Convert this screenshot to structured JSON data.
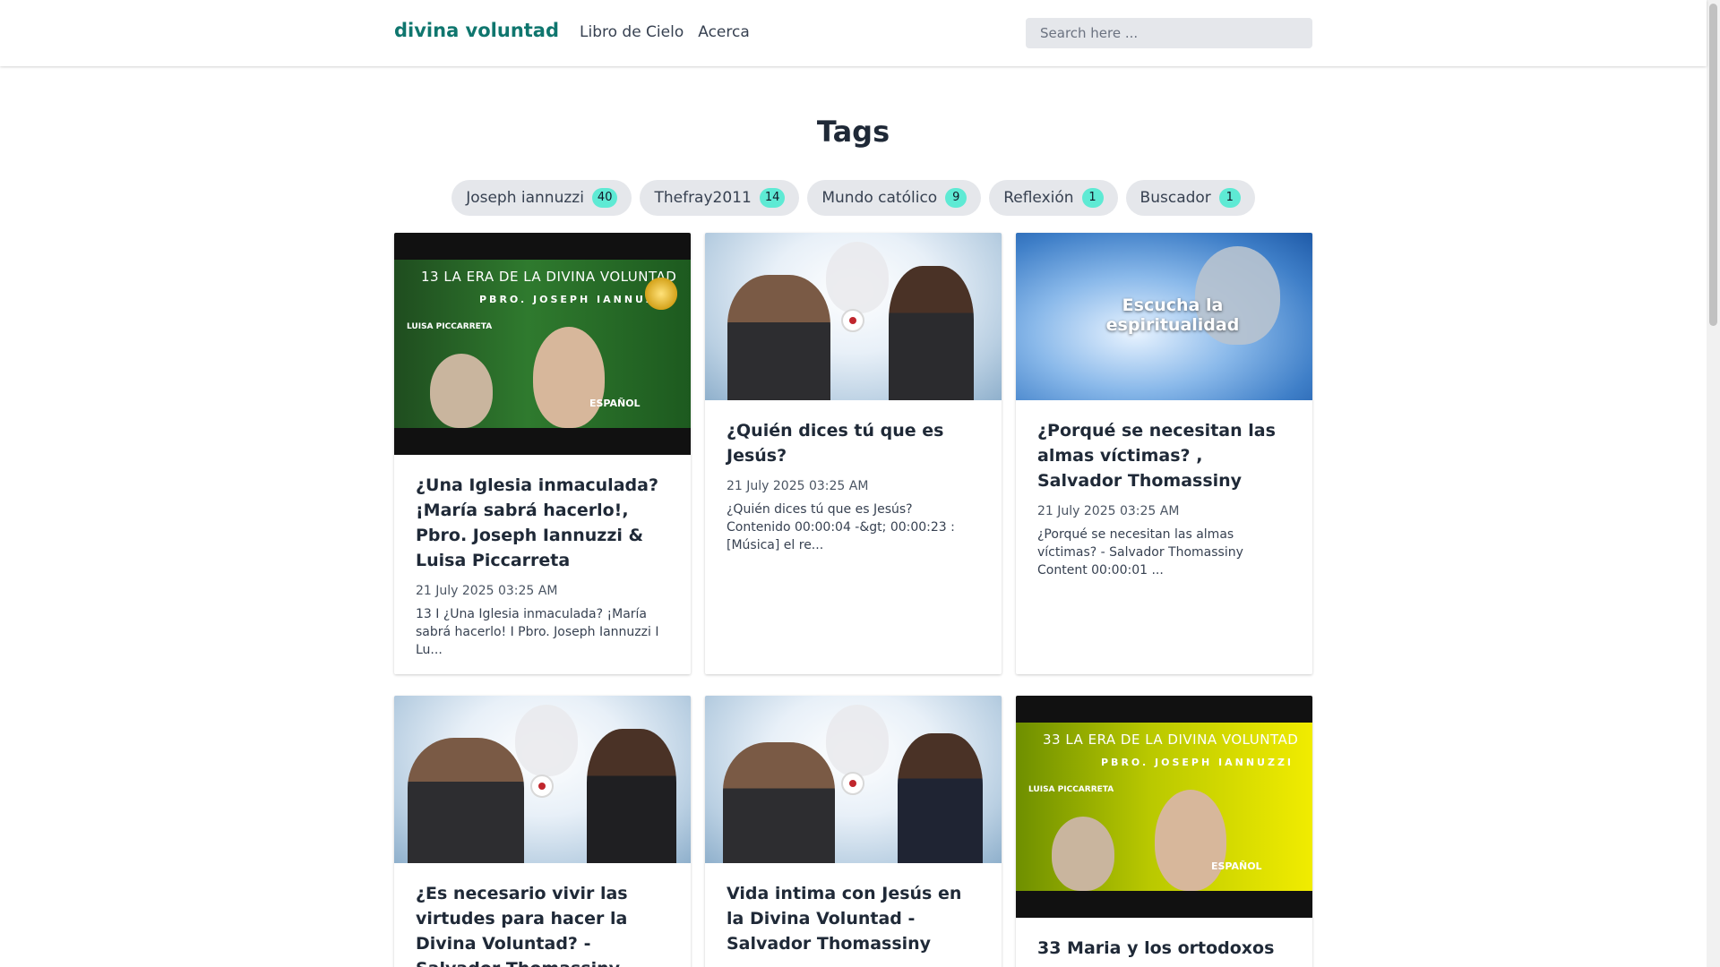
{
  "header": {
    "brand": "divina voluntad",
    "nav": [
      "Libro de Cielo",
      "Acerca"
    ],
    "search_placeholder": "Search here ..."
  },
  "page_title": "Tags",
  "tags": [
    {
      "label": "Joseph iannuzzi",
      "count": "40"
    },
    {
      "label": "Thefray2011",
      "count": "14"
    },
    {
      "label": "Mundo católico",
      "count": "9"
    },
    {
      "label": "Reflexión",
      "count": "1"
    },
    {
      "label": "Buscador",
      "count": "1"
    }
  ],
  "thumb_text": {
    "era13": "13   LA ERA DE LA DIVINA VOLUNTAD",
    "era33": "33   LA ERA DE LA DIVINA VOLUNTAD",
    "priest": "PBRO.  JOSEPH  IANNUZZI",
    "luisa": "LUISA PICCARRETA",
    "lang": "ESPAÑOL",
    "spirit": "Escucha la espiritualidad"
  },
  "cards": [
    {
      "title": "¿Una Iglesia inmaculada? ¡María sabrá hacerlo!, Pbro. Joseph Iannuzzi & Luisa Piccarreta",
      "date": "21 July 2025 03:25 AM",
      "excerpt": "13 I ¿Una Iglesia inmaculada? ¡María sabrá hacerlo! I Pbro. Joseph Iannuzzi I Lu..."
    },
    {
      "title": "¿Quién dices tú que es Jesús?",
      "date": "21 July 2025 03:25 AM",
      "excerpt": "¿Quién dices tú que es Jesús? Contenido 00:00:04 -&gt; 00:00:23 : [Música] el re..."
    },
    {
      "title": "¿Porqué se necesitan las almas víctimas? , Salvador Thomassiny",
      "date": "21 July 2025 03:25 AM",
      "excerpt": "¿Porqué se necesitan las almas víctimas? - Salvador Thomassiny Content 00:00:01 ..."
    },
    {
      "title": "¿Es necesario vivir las virtudes para hacer la Divina Voluntad? - Salvador Thomassiny",
      "date": "",
      "excerpt": ""
    },
    {
      "title": "Vida intima con Jesús en la Divina Voluntad - Salvador Thomassiny",
      "date": "",
      "excerpt": ""
    },
    {
      "title": "33 Maria y los ortodoxos",
      "date": "",
      "excerpt": ""
    }
  ]
}
